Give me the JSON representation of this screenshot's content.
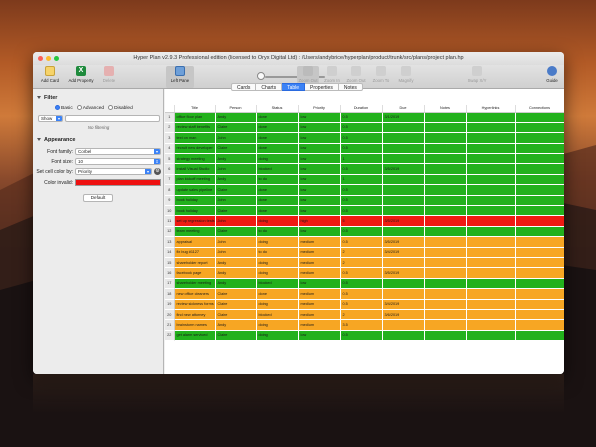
{
  "window": {
    "title": "Hyper Plan v2.9.3 Professional edition (licensed to Oryx Digital Ltd) : /Users/andybrice/hyperplan/product/trunk/src/plans/project plan.hp"
  },
  "toolbar": {
    "add_card": "Add Card",
    "add_property": "Add Property",
    "delete": "Delete",
    "left_pane": "Left Pane",
    "zoom_out": "Zoom Out",
    "zoom_in": "Zoom In",
    "zoom_out_2": "Zoom Out",
    "zoom_to": "Zoom To",
    "magnify": "Magnify",
    "swap_xy": "Swap X/Y",
    "guide": "Guide"
  },
  "tabs": [
    {
      "label": "Cards"
    },
    {
      "label": "Charts"
    },
    {
      "label": "Table"
    },
    {
      "label": "Properties"
    },
    {
      "label": "Notes"
    }
  ],
  "sidebar": {
    "filter": {
      "heading": "Filter",
      "modes": [
        "Basic",
        "Advanced",
        "Disabled"
      ],
      "show_label": "Show",
      "status": "No filtering"
    },
    "appearance": {
      "heading": "Appearance",
      "font_family_label": "Font family:",
      "font_family_value": "Corbel",
      "font_size_label": "Font size:",
      "font_size_value": "10",
      "cell_color_label": "Set cell color by:",
      "cell_color_value": "Priority",
      "color_invalid_label": "Color invalid:",
      "color_invalid_swatch": "#ee1111",
      "default_button": "Default"
    }
  },
  "table": {
    "columns": [
      "Title",
      "Person",
      "Status",
      "Priority",
      "Duration",
      "Due",
      "Notes",
      "Hyperlinks",
      "Connections"
    ],
    "priority_colors": {
      "low": "#22b11c",
      "high": "#ef1b12",
      "medium": "#f7a623"
    },
    "rows": [
      {
        "n": "1",
        "title": "office floor plan",
        "person": "Andy",
        "status": "done",
        "priority": "low",
        "duration": "0.5",
        "due": "3/1/2019",
        "color": "green"
      },
      {
        "n": "2",
        "title": "review staff benefits",
        "person": "Claire",
        "status": "done",
        "priority": "low",
        "duration": "0.5",
        "due": "",
        "color": "green"
      },
      {
        "n": "3",
        "title": "text on man",
        "person": "John",
        "status": "done",
        "priority": "low",
        "duration": "0.5",
        "due": "",
        "color": "green"
      },
      {
        "n": "4",
        "title": "recruit new developer",
        "person": "Claire",
        "status": "done",
        "priority": "low",
        "duration": "0.5",
        "due": "",
        "color": "green"
      },
      {
        "n": "5",
        "title": "strategy meeting",
        "person": "Andy",
        "status": "doing",
        "priority": "low",
        "duration": "1",
        "due": "",
        "color": "green"
      },
      {
        "n": "6",
        "title": "install Visual Studio",
        "person": "John",
        "status": "blocked",
        "priority": "low",
        "duration": "0.5",
        "due": "3/5/2019",
        "color": "green"
      },
      {
        "n": "7",
        "title": "plan kickoff meeting",
        "person": "Andy",
        "status": "to do",
        "priority": "low",
        "duration": "1",
        "due": "",
        "color": "green"
      },
      {
        "n": "8",
        "title": "update sales pipeline",
        "person": "Claire",
        "status": "done",
        "priority": "low",
        "duration": "0.5",
        "due": "",
        "color": "green"
      },
      {
        "n": "9",
        "title": "book holiday",
        "person": "John",
        "status": "done",
        "priority": "low",
        "duration": "0.5",
        "due": "",
        "color": "green"
      },
      {
        "n": "10",
        "title": "book holiday",
        "person": "Claire",
        "status": "done",
        "priority": "low",
        "duration": "0.5",
        "due": "",
        "color": "green"
      },
      {
        "n": "11",
        "title": "set up regression tests",
        "person": "John",
        "status": "doing",
        "priority": "high",
        "duration": "5",
        "due": "3/5/2019",
        "color": "red"
      },
      {
        "n": "12",
        "title": "team meeting",
        "person": "Claire",
        "status": "to do",
        "priority": "low",
        "duration": "0.5",
        "due": "",
        "color": "green"
      },
      {
        "n": "13",
        "title": "appraisal",
        "person": "John",
        "status": "doing",
        "priority": "medium",
        "duration": "0.5",
        "due": "3/5/2019",
        "color": "orange"
      },
      {
        "n": "14",
        "title": "fix bug #1127",
        "person": "John",
        "status": "to do",
        "priority": "medium",
        "duration": "2",
        "due": "3/4/2019",
        "color": "orange"
      },
      {
        "n": "15",
        "title": "shareholder report",
        "person": "Andy",
        "status": "doing",
        "priority": "medium",
        "duration": "2",
        "due": "",
        "color": "orange"
      },
      {
        "n": "16",
        "title": "facebook page",
        "person": "Andy",
        "status": "doing",
        "priority": "medium",
        "duration": "0.5",
        "due": "3/5/2019",
        "color": "orange"
      },
      {
        "n": "17",
        "title": "shareholder meeting",
        "person": "Andy",
        "status": "blocked",
        "priority": "low",
        "duration": "0.5",
        "due": "",
        "color": "green"
      },
      {
        "n": "18",
        "title": "new office cleaners",
        "person": "Claire",
        "status": "done",
        "priority": "medium",
        "duration": "0.5",
        "due": "",
        "color": "orange"
      },
      {
        "n": "19",
        "title": "review sickness forms",
        "person": "Claire",
        "status": "doing",
        "priority": "medium",
        "duration": "0.5",
        "due": "3/4/2019",
        "color": "orange"
      },
      {
        "n": "20",
        "title": "find new attorney",
        "person": "Claire",
        "status": "blocked",
        "priority": "medium",
        "duration": "2",
        "due": "3/6/2019",
        "color": "orange"
      },
      {
        "n": "21",
        "title": "brainstorm names",
        "person": "Andy",
        "status": "doing",
        "priority": "medium",
        "duration": "3.5",
        "due": "",
        "color": "orange"
      },
      {
        "n": "22",
        "title": "get alarm serviced",
        "person": "Claire",
        "status": "doing",
        "priority": "low",
        "duration": "0.5",
        "due": "",
        "color": "green"
      }
    ]
  }
}
